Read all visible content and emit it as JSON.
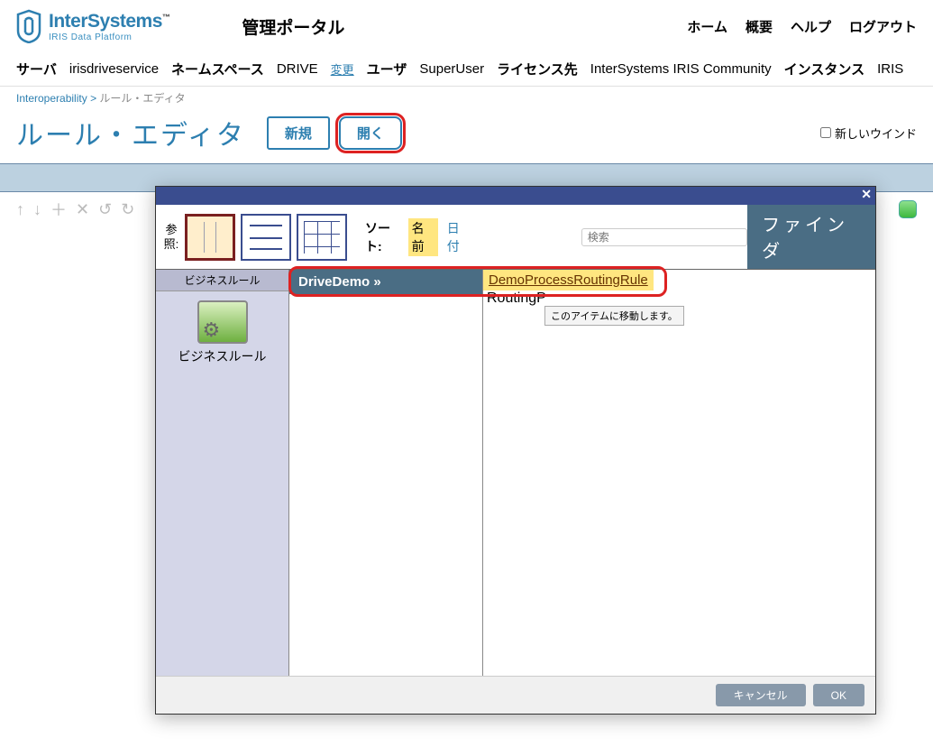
{
  "header": {
    "logo_main": "InterSystems",
    "logo_sub": "IRIS Data Platform",
    "portal_title": "管理ポータル",
    "nav": {
      "home": "ホーム",
      "overview": "概要",
      "help": "ヘルプ",
      "logout": "ログアウト"
    }
  },
  "info": {
    "server_lbl": "サーバ",
    "server_val": "irisdriveservice",
    "ns_lbl": "ネームスペース",
    "ns_val": "DRIVE",
    "change": "変更",
    "user_lbl": "ユーザ",
    "user_val": "SuperUser",
    "lic_lbl": "ライセンス先",
    "lic_val": "InterSystems IRIS Community",
    "inst_lbl": "インスタンス",
    "inst_val": "IRIS"
  },
  "breadcrumb": {
    "root": "Interoperability",
    "sep": ">",
    "current": "ルール・エディタ"
  },
  "page": {
    "title": "ルール・エディタ",
    "new_btn": "新規",
    "open_btn": "開く",
    "new_window": "新しいウインド"
  },
  "dialog": {
    "ref_label": "参照:",
    "sort_lbl": "ソート:",
    "sort_name": "名前",
    "sort_date": "日付",
    "search_ph": "検索",
    "finder": "ファインダ",
    "cat_header": "ビジネスルール",
    "cat_label": "ビジネスルール",
    "package": "DriveDemo",
    "rule1": "DemoProcessRoutingRule",
    "rule2_partial": "RoutingP",
    "tooltip": "このアイテムに移動します。",
    "cancel": "キャンセル",
    "ok": "OK"
  }
}
